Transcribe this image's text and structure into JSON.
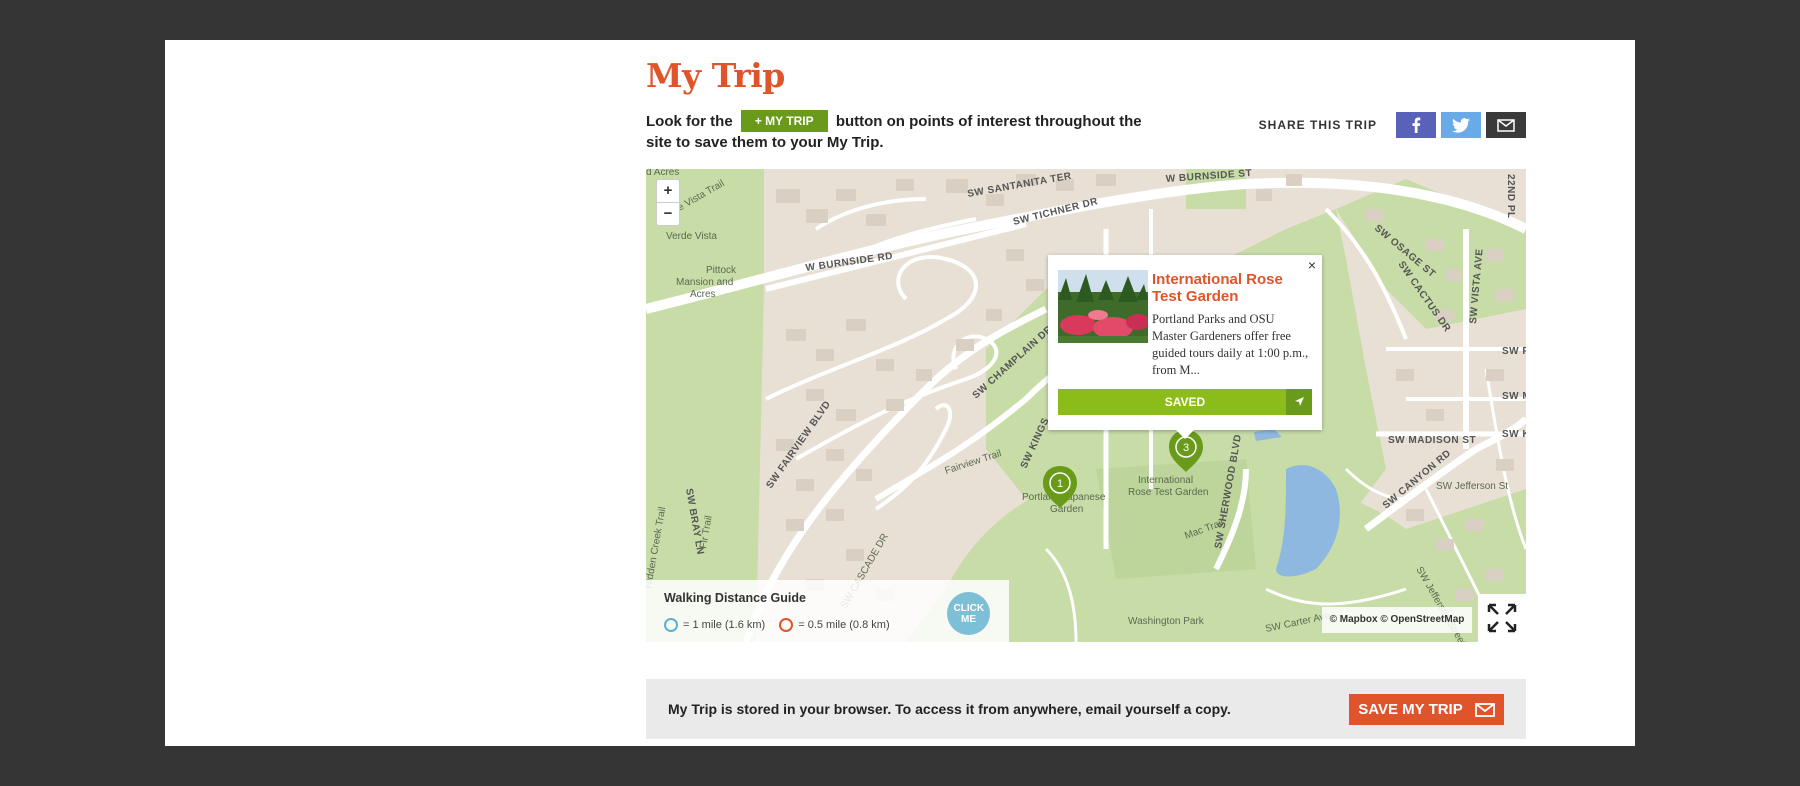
{
  "page": {
    "title": "My Trip",
    "intro_before": "Look for the",
    "intro_button": "+ MY TRIP",
    "intro_after": "button on points of interest throughout the site to save them to your My Trip."
  },
  "share": {
    "label": "SHARE THIS TRIP",
    "facebook_icon": "facebook-icon",
    "twitter_icon": "twitter-icon",
    "email_icon": "envelope-icon"
  },
  "map": {
    "zoom_in": "+",
    "zoom_out": "−",
    "streets": [
      "W BURNSIDE ST",
      "W BURNSIDE RD",
      "SW TICHNER DR",
      "SW SANTANITA TER",
      "SW FAIRVIEW BLVD",
      "SW CHAMPLAIN DR",
      "SW SHERWOOD BLVD",
      "SW CANYON RD",
      "SW MADISON ST",
      "SW OSAGE ST",
      "SW CACTUS DR",
      "SW VISTA AVE",
      "22ND PL",
      "SW BRAY LN",
      "SW KINGS",
      "SW MA",
      "SW KI",
      "SW P",
      "SW Jefferson St",
      "SW Carter Ave",
      "Mac Trail",
      "Fairview Trail",
      "Valle Vista Trail",
      "Verde Vista",
      "SW CASCADE DR",
      "Fir Trail",
      "Hidden Creek Trail",
      "SW Jefferson Street Ext"
    ],
    "places": [
      "Pittock Mansion and Acres",
      "International Rose Test Garden",
      "Portland Japanese Garden",
      "Washington Park",
      "d Acres"
    ],
    "markers": [
      "1",
      "3"
    ],
    "attribution_mapbox": "© Mapbox",
    "attribution_osm": "© OpenStreetMap"
  },
  "popup": {
    "title": "International Rose Test Garden",
    "description": "Portland Parks and OSU Master Gardeners offer free guided tours daily at 1:00 p.m., from M...",
    "saved_label": "SAVED",
    "close": "×"
  },
  "walk_guide": {
    "title": "Walking Distance Guide",
    "legend_1": "= 1 mile (1.6 km)",
    "legend_2": "= 0.5 mile (0.8 km)",
    "click_me": "CLICK ME",
    "color_1": "#5ab0d8",
    "color_2": "#e0542c"
  },
  "footer": {
    "text": "My Trip is stored in your browser. To access it from anywhere, email yourself a copy.",
    "save_button": "SAVE MY TRIP"
  },
  "colors": {
    "accent": "#e0542c",
    "green": "#6a9a1a",
    "saved_green": "#8cbc1a",
    "park": "#c8dca8",
    "land": "#e8e0d5"
  }
}
